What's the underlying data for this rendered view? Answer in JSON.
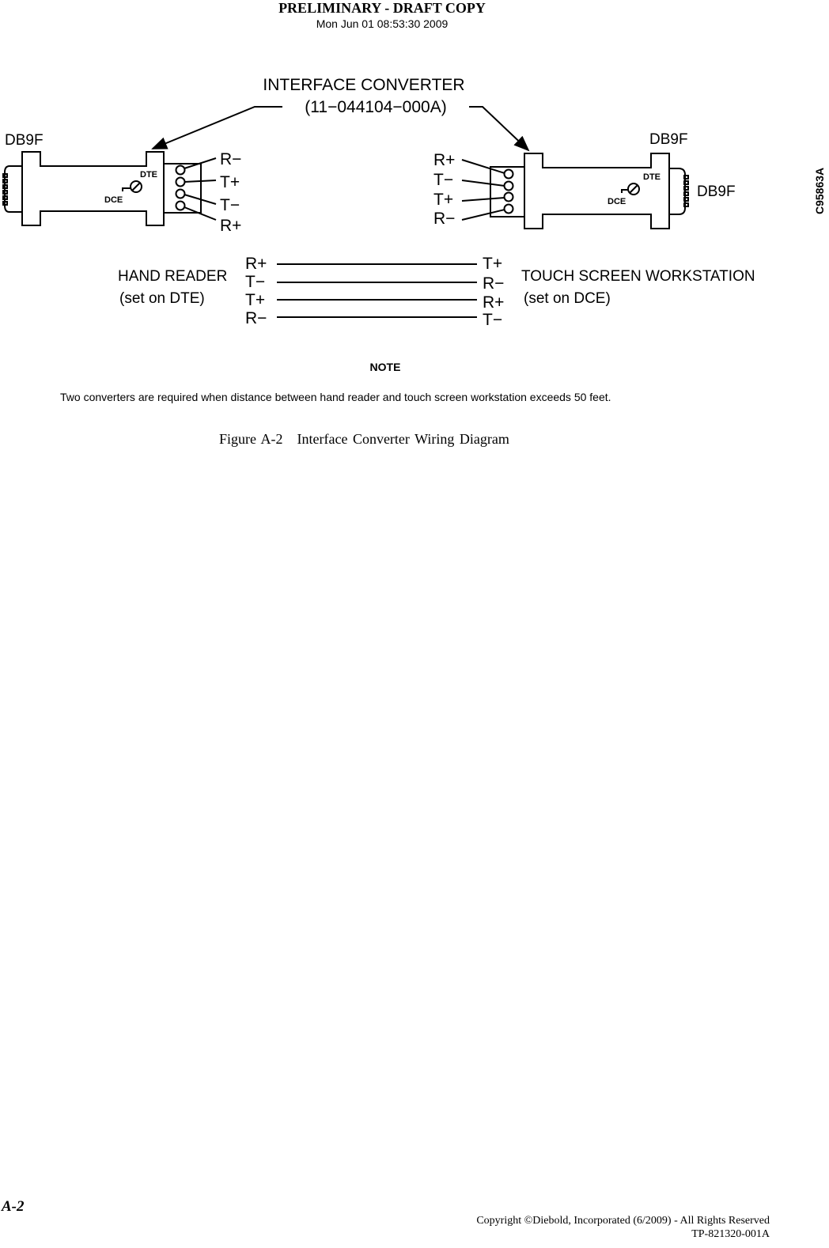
{
  "header": {
    "title": "PRELIMINARY - DRAFT COPY",
    "timestamp": "Mon Jun 01 08:53:30 2009"
  },
  "diagram": {
    "callout": {
      "title": "INTERFACE  CONVERTER",
      "part_number": "(11−044104−000A)"
    },
    "drawing_id": "C95863A",
    "left_converter": {
      "connector_label": "DB9F",
      "switch_labels": {
        "dte": "DTE",
        "dce": "DCE"
      },
      "terminals": [
        "R−",
        "T+",
        "T−",
        "R+"
      ]
    },
    "right_converter": {
      "connector_label_top": "DB9F",
      "connector_label_side": "DB9F",
      "switch_labels": {
        "dte": "DTE",
        "dce": "DCE"
      },
      "terminals": [
        "R+",
        "T−",
        "T+",
        "R−"
      ]
    },
    "wiring": {
      "left_device": {
        "name": "HAND  READER",
        "setting": "(set  on  DTE)"
      },
      "right_device": {
        "name": "TOUCH  SCREEN  WORKSTATION",
        "setting": "(set  on  DCE)"
      },
      "connections": [
        {
          "from": "R+",
          "to": "T+"
        },
        {
          "from": "T−",
          "to": "R−"
        },
        {
          "from": "T+",
          "to": "R+"
        },
        {
          "from": "R−",
          "to": "T−"
        }
      ]
    }
  },
  "note": {
    "title": "NOTE",
    "text": "Two converters are required when distance between hand reader and touch screen workstation exceeds 50 feet."
  },
  "figure": {
    "number": "Figure  A-2",
    "title": "Interface Converter Wiring Diagram"
  },
  "footer": {
    "page_number": "A-2",
    "copyright": "Copyright ©Diebold, Incorporated (6/2009) - All Rights Reserved",
    "doc_number": "TP-821320-001A"
  }
}
